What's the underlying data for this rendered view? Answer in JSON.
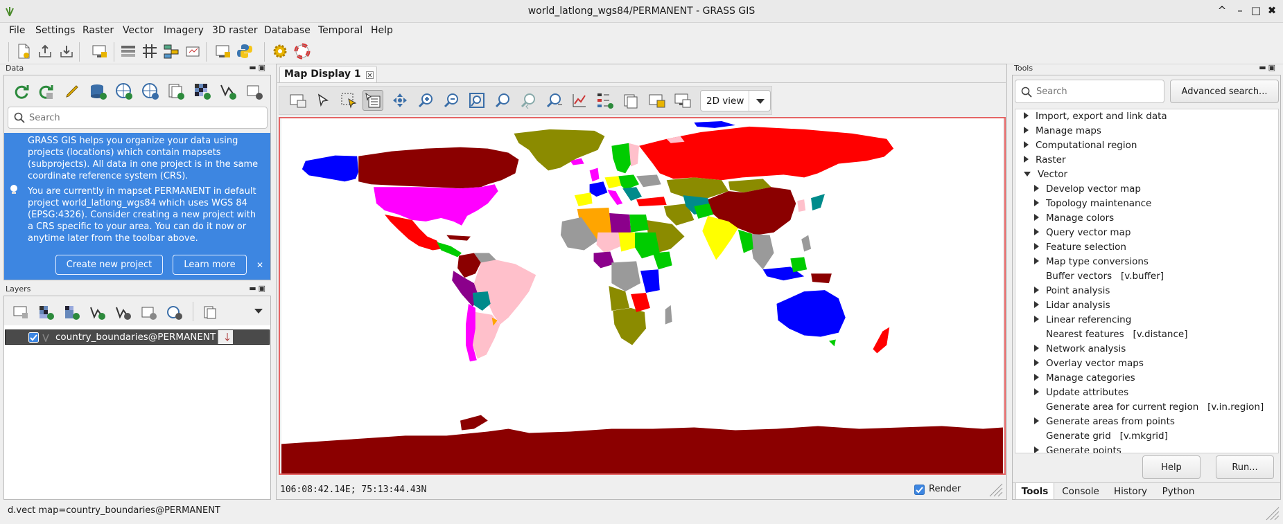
{
  "window": {
    "title": "world_latlong_wgs84/PERMANENT - GRASS GIS",
    "controls": [
      "^",
      "–",
      "□",
      "✖"
    ]
  },
  "menu": [
    "File",
    "Settings",
    "Raster",
    "Vector",
    "Imagery",
    "3D raster",
    "Database",
    "Temporal",
    "Help"
  ],
  "data_panel": {
    "title": "Data",
    "search_placeholder": "Search",
    "info_paragraph_1": "GRASS GIS helps you organize your data using projects (locations) which contain mapsets (subprojects). All data in one project is in the same coordinate reference system (CRS).",
    "info_paragraph_2": "You are currently in mapset PERMANENT in default project world_latlong_wgs84 which uses WGS 84 (EPSG:4326). Consider creating a new project with a CRS specific to your area. You can do it now or anytime later from the toolbar above.",
    "create_button": "Create new project",
    "learn_button": "Learn more",
    "close_glyph": "✕"
  },
  "layers_panel": {
    "title": "Layers",
    "layer_name": "country_boundaries@PERMANENT",
    "layer_checked": true
  },
  "map_display": {
    "tab_label": "Map Display 1",
    "view_mode": "2D view",
    "coordinates": "106:08:42.14E; 75:13:44.43N",
    "render_label": "Render",
    "render_checked": true,
    "colors": {
      "ocean": "#ffffff",
      "maroon": "#8b0000",
      "red": "#ff0000",
      "magenta": "#ff00ff",
      "blue": "#0000ff",
      "olive": "#8b8b00",
      "pink": "#ffc0cb",
      "gray": "#9a9a9a",
      "orange": "#ffa500",
      "green": "#00cc00",
      "purple": "#8b008b",
      "teal": "#008b8b",
      "yellow": "#ffff00"
    }
  },
  "tools_panel": {
    "title": "Tools",
    "search_placeholder": "Search",
    "advanced_button": "Advanced search...",
    "tree": [
      {
        "label": "Import, export and link data",
        "level": 0,
        "state": "collapsed"
      },
      {
        "label": "Manage maps",
        "level": 0,
        "state": "collapsed"
      },
      {
        "label": "Computational region",
        "level": 0,
        "state": "collapsed"
      },
      {
        "label": "Raster",
        "level": 0,
        "state": "collapsed"
      },
      {
        "label": "Vector",
        "level": 0,
        "state": "expanded"
      },
      {
        "label": "Develop vector map",
        "level": 1,
        "state": "collapsed"
      },
      {
        "label": "Topology maintenance",
        "level": 1,
        "state": "collapsed"
      },
      {
        "label": "Manage colors",
        "level": 1,
        "state": "collapsed"
      },
      {
        "label": "Query vector map",
        "level": 1,
        "state": "collapsed"
      },
      {
        "label": "Feature selection",
        "level": 1,
        "state": "collapsed"
      },
      {
        "label": "Map type conversions",
        "level": 1,
        "state": "collapsed"
      },
      {
        "label": "Buffer vectors   [v.buffer]",
        "level": 1,
        "state": "leaf"
      },
      {
        "label": "Point analysis",
        "level": 1,
        "state": "collapsed"
      },
      {
        "label": "Lidar analysis",
        "level": 1,
        "state": "collapsed"
      },
      {
        "label": "Linear referencing",
        "level": 1,
        "state": "collapsed"
      },
      {
        "label": "Nearest features   [v.distance]",
        "level": 1,
        "state": "leaf"
      },
      {
        "label": "Network analysis",
        "level": 1,
        "state": "collapsed"
      },
      {
        "label": "Overlay vector maps",
        "level": 1,
        "state": "collapsed"
      },
      {
        "label": "Manage categories",
        "level": 1,
        "state": "collapsed"
      },
      {
        "label": "Update attributes",
        "level": 1,
        "state": "collapsed"
      },
      {
        "label": "Generate area for current region   [v.in.region]",
        "level": 1,
        "state": "leaf"
      },
      {
        "label": "Generate areas from points",
        "level": 1,
        "state": "collapsed"
      },
      {
        "label": "Generate grid   [v.mkgrid]",
        "level": 1,
        "state": "leaf"
      },
      {
        "label": "Generate points",
        "level": 1,
        "state": "collapsed"
      }
    ],
    "help_button": "Help",
    "run_button": "Run...",
    "tabs": [
      "Tools",
      "Console",
      "History",
      "Python"
    ],
    "active_tab": "Tools"
  },
  "status_bar": {
    "command": "d.vect map=country_boundaries@PERMANENT"
  }
}
